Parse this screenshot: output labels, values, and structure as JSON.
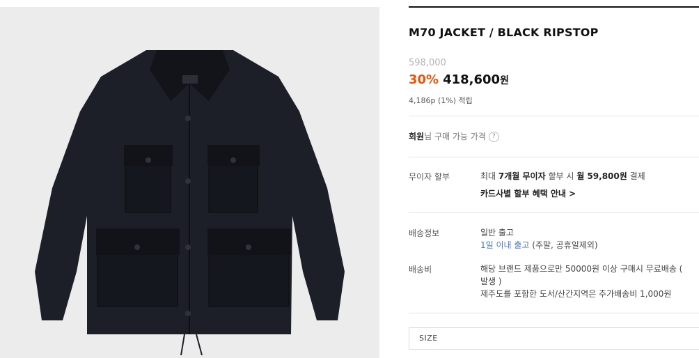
{
  "product": {
    "title": "M70 JACKET / BLACK RIPSTOP",
    "original_price": "598,000",
    "discount": "30%",
    "price": "418,600",
    "currency": "원",
    "points": "4,186p (1%) 적립"
  },
  "member": {
    "bold": "회원",
    "rest": "님 구매 가능 가격",
    "help_icon": "?"
  },
  "installment": {
    "label": "무이자 할부",
    "text_1": "최대 ",
    "bold_1": "7개월 무이자",
    "text_2": " 할부 시 ",
    "bold_2": "월 59,800원",
    "text_3": " 결제",
    "card_link": "카드사별 할부 혜택 안내 >"
  },
  "shipping": {
    "label": "배송정보",
    "line1": "일반 출고",
    "line2_blue": "1일 이내 출고",
    "line2_rest": " (주말, 공휴일제외)"
  },
  "shipping_fee": {
    "label": "배송비",
    "line1": "해당 브랜드 제품으로만 50000원 이상 구매시 무료배송 (",
    "line2": "발생 )",
    "line3": "제주도를 포함한 도서/산간지역은 추가배송비 1,000원"
  },
  "size": {
    "label": "SIZE"
  }
}
